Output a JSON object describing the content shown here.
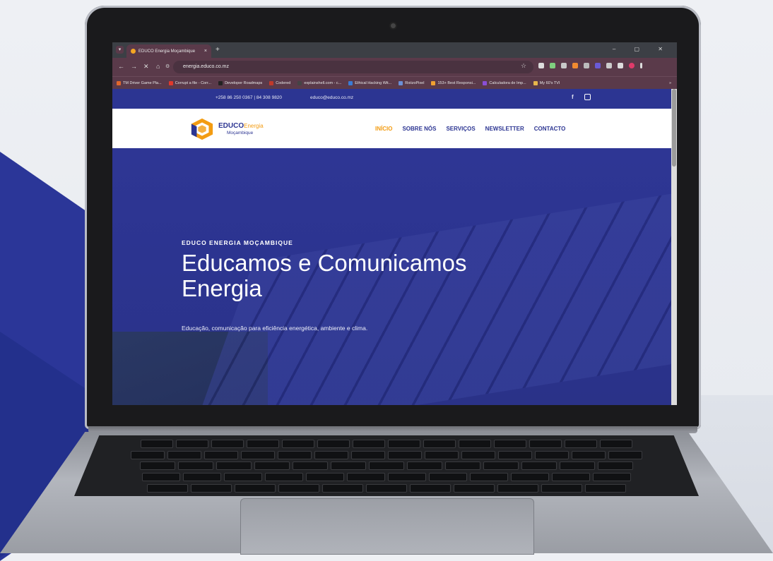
{
  "browser": {
    "tab_title": "EDUCO Energia Moçambique",
    "tab_close": "×",
    "new_tab": "+",
    "url": "energia.educo.co.mz",
    "window_controls": "–  ▢  ✕",
    "bookmarks": [
      {
        "label": "TM Driver Game Pla...",
        "color": "#e0672c"
      },
      {
        "label": "Corrupt a file - Corr...",
        "color": "#e0392c"
      },
      {
        "label": "Developer Roadmaps",
        "color": "#222222"
      },
      {
        "label": "Codered",
        "color": "#c0392b"
      },
      {
        "label": "explainshell.com - c...",
        "color": "#444444"
      },
      {
        "label": "Ethical Hacking Wit...",
        "color": "#3a7bd5"
      },
      {
        "label": "RoiizoPixel",
        "color": "#6b8fd6"
      },
      {
        "label": "153+ Best Responsi...",
        "color": "#f0a030"
      },
      {
        "label": "Calculadora de Imp...",
        "color": "#8a4fd6"
      },
      {
        "label": "My 60's TVI",
        "color": "#e8b64a"
      }
    ],
    "bookmarks_more": "»"
  },
  "site": {
    "topbar": {
      "phone": "+258 86 250 0367 | 84 308 9820",
      "email": "educo@educo.co.mz",
      "facebook": "f"
    },
    "logo": {
      "brand_bold": "EDUCO",
      "brand_light": "Energia",
      "sub": "Moçambique"
    },
    "menu": [
      "INÍCIO",
      "SOBRE NÓS",
      "SERVIÇOS",
      "NEWSLETTER",
      "CONTACTO"
    ],
    "hero": {
      "kicker": "EDUCO ENERGIA MOÇAMBIQUE",
      "headline": "Educamos e Comunicamos Energia",
      "tagline": "Educação, comunicação para eficiência energética, ambiente e clima."
    }
  },
  "colors": {
    "brand_blue": "#2c3592",
    "accent_orange": "#f39c12",
    "chrome_tab": "#5a3a4a"
  }
}
